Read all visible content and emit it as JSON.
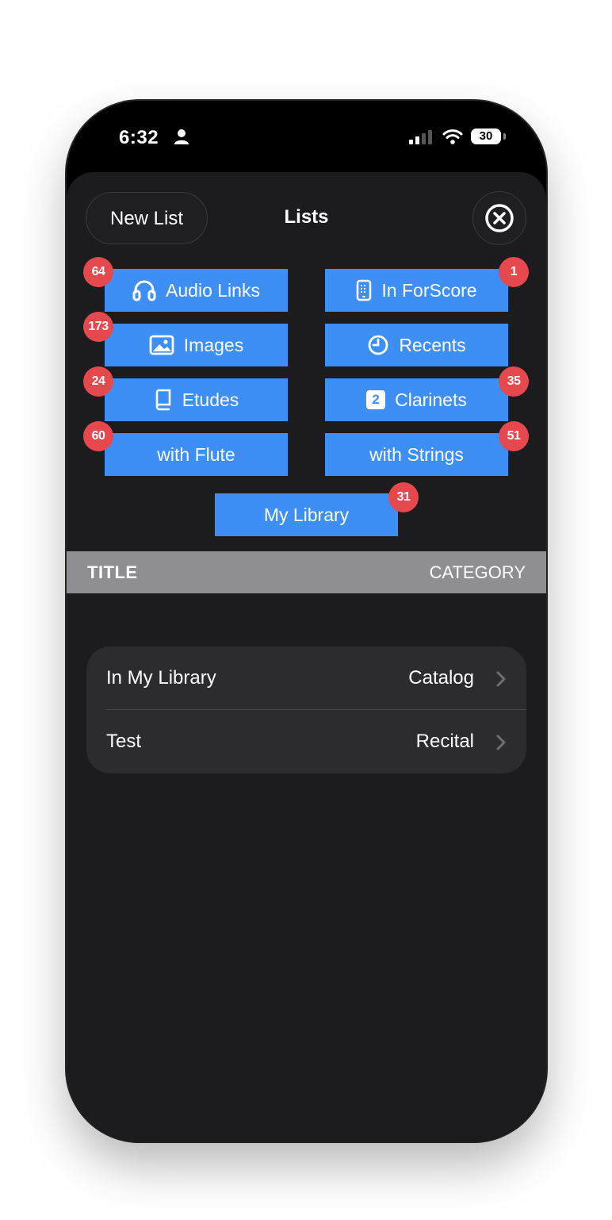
{
  "status_bar": {
    "time": "6:32",
    "battery": "30"
  },
  "sheet": {
    "title": "Lists",
    "new_list_label": "New List"
  },
  "lists": [
    {
      "label": "Audio Links",
      "icon": "headphones-icon",
      "badge": "64"
    },
    {
      "label": "In ForScore",
      "icon": "device-icon",
      "badge": "1"
    },
    {
      "label": "Images",
      "icon": "photo-icon",
      "badge": "173"
    },
    {
      "label": "Recents",
      "icon": "clock-icon",
      "badge": ""
    },
    {
      "label": "Etudes",
      "icon": "book-icon",
      "badge": "24"
    },
    {
      "label": "Clarinets",
      "icon": "number-2-icon",
      "icon_text": "2",
      "badge": "35"
    },
    {
      "label": "with Flute",
      "icon": "",
      "badge": "60"
    },
    {
      "label": "with Strings",
      "icon": "",
      "badge": "51"
    },
    {
      "label": "My Library",
      "icon": "",
      "badge": "31"
    }
  ],
  "table_header": {
    "title": "TITLE",
    "category": "CATEGORY"
  },
  "rows": [
    {
      "title": "In My Library",
      "category": "Catalog"
    },
    {
      "title": "Test",
      "category": "Recital"
    }
  ],
  "colors": {
    "accent": "#3d8ff5",
    "badge": "#e5484d",
    "sheet_bg": "#1c1c1e",
    "header_bg": "#8e8e93"
  }
}
